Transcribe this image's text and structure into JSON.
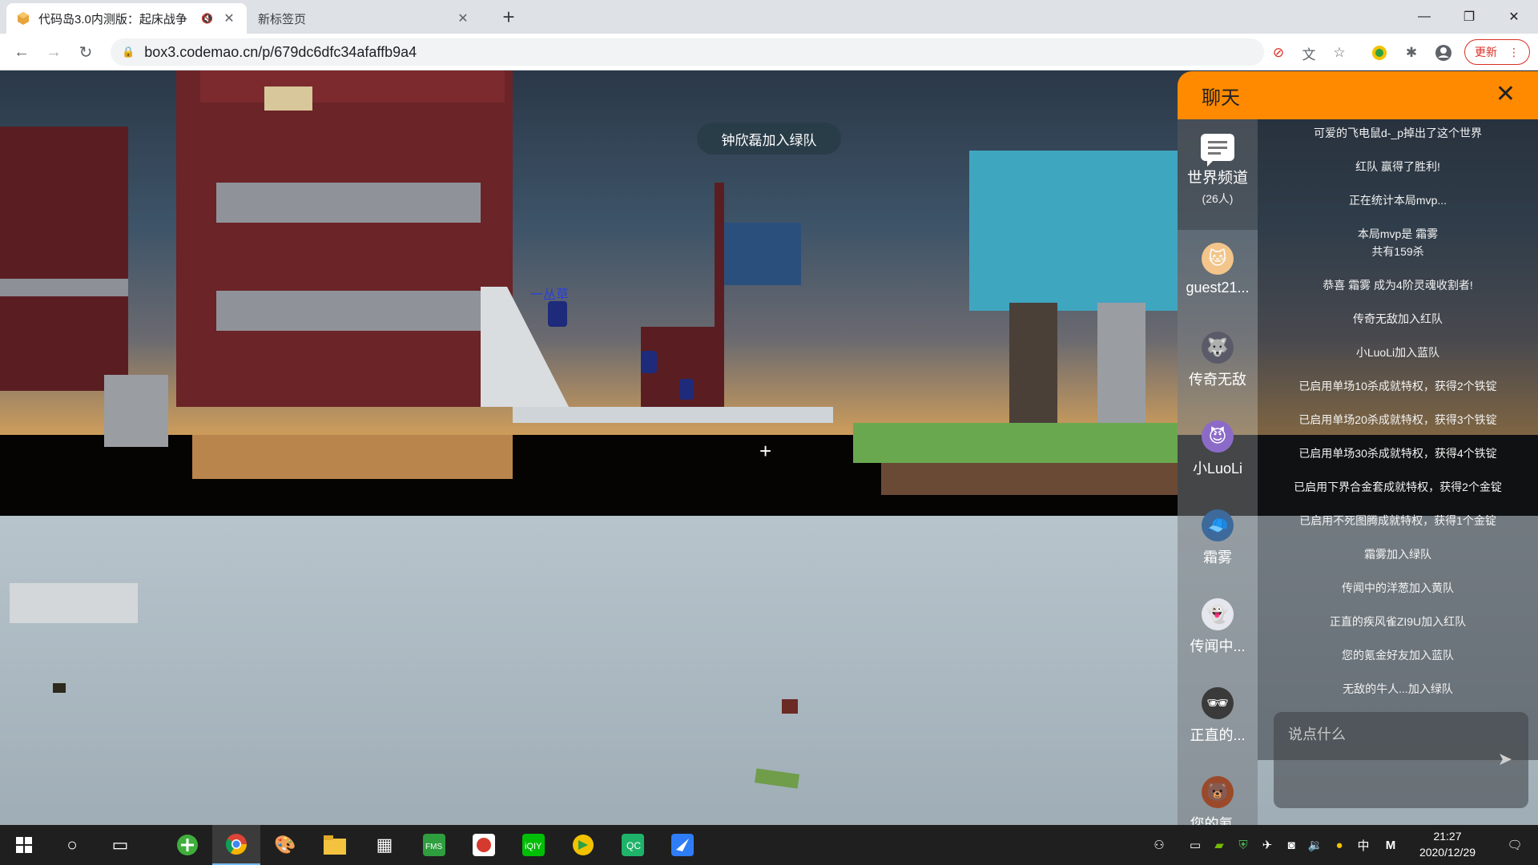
{
  "browser": {
    "tabs": [
      {
        "title": "代码岛3.0内测版：起床战争",
        "active": true
      },
      {
        "title": "新标签页",
        "active": false
      }
    ],
    "url": "box3.codemao.cn/p/679dc6dfc34afaffb9a4",
    "update_label": "更新"
  },
  "game": {
    "banner": "钟欣磊加入绿队",
    "player_nametag": "一丛草"
  },
  "chat": {
    "title": "聊天",
    "channel": {
      "name": "世界频道",
      "count": "(26人)"
    },
    "members": [
      "guest21...",
      "传奇无敌",
      "小LuoLi",
      "霜雾",
      "传闻中...",
      "正直的...",
      "您的氪..."
    ],
    "messages": [
      "可爱的飞电鼠d-_p掉出了这个世界",
      "红队 赢得了胜利!",
      "正在统计本局mvp...",
      "本局mvp是 霜雾",
      "共有159杀",
      "恭喜 霜雾 成为4阶灵魂收割者!",
      "传奇无敌加入红队",
      "小LuoLi加入蓝队",
      "已启用单场10杀成就特权，获得2个铁锭",
      "已启用单场20杀成就特权，获得3个铁锭",
      "已启用单场30杀成就特权，获得4个铁锭",
      "已启用下界合金套成就特权，获得2个金锭",
      "已启用不死图腾成就特权，获得1个金锭",
      "霜雾加入绿队",
      "传闻中的洋葱加入黄队",
      "正直的疾风雀ZI9U加入红队",
      "您的氪金好友加入蓝队",
      "无敌的牛人...加入绿队"
    ],
    "input_placeholder": "说点什么"
  },
  "taskbar": {
    "ime_lang": "中",
    "ime_mode": "M",
    "time": "21:27",
    "date": "2020/12/29"
  },
  "colors": {
    "chat_header": "#ff8a00",
    "nametag": "#2b3fd6"
  }
}
